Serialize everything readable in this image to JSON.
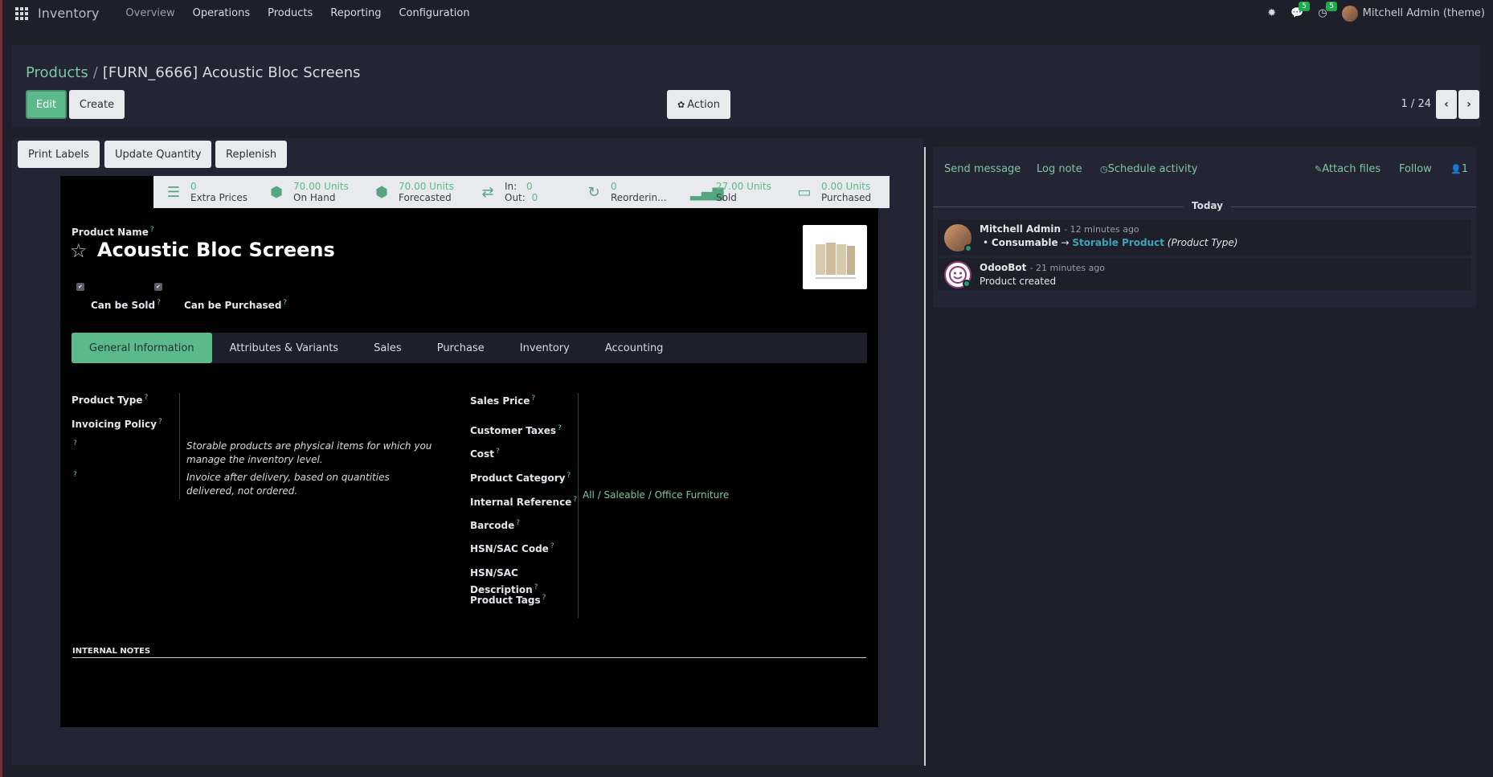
{
  "navbar": {
    "brand": "Inventory",
    "menu": [
      "Overview",
      "Operations",
      "Products",
      "Reporting",
      "Configuration"
    ],
    "messages_count": "5",
    "activities_count": "5",
    "user": "Mitchell Admin (theme)"
  },
  "control_panel": {
    "breadcrumb_parent": "Products",
    "breadcrumb_sep": "/",
    "breadcrumb_current": "[FURN_6666] Acoustic Bloc Screens",
    "edit_label": "Edit",
    "create_label": "Create",
    "action_label": "Action",
    "pager": "1 / 24"
  },
  "status_buttons": {
    "print_labels": "Print Labels",
    "update_quantity": "Update Quantity",
    "replenish": "Replenish"
  },
  "stats": [
    {
      "value": "0",
      "label": "Extra Prices",
      "icon": "list-icon"
    },
    {
      "value": "70.00 Units",
      "label": "On Hand",
      "icon": "cubes-icon"
    },
    {
      "value": "70.00 Units",
      "label": "Forecasted",
      "icon": "cubes-icon"
    },
    {
      "in_label": "In:",
      "in_value": "0",
      "out_label": "Out:",
      "out_value": "0",
      "icon": "exchange-icon"
    },
    {
      "value": "0",
      "label": "Reorderin...",
      "icon": "refresh-icon"
    },
    {
      "value": "27.00 Units",
      "label": "Sold",
      "icon": "signal-icon"
    },
    {
      "value": "0.00 Units",
      "label": "Purchased",
      "icon": "credit-card-icon"
    }
  ],
  "product": {
    "name_label": "Product Name",
    "name": "Acoustic Bloc Screens",
    "can_be_sold": "Can be Sold",
    "can_be_purchased": "Can be Purchased"
  },
  "tabs": [
    "General Information",
    "Attributes & Variants",
    "Sales",
    "Purchase",
    "Inventory",
    "Accounting"
  ],
  "general": {
    "product_type": "Product Type",
    "invoicing_policy": "Invoicing Policy",
    "help_type": "Storable products are physical items for which you manage the inventory level.",
    "help_invoice": "Invoice after delivery, based on quantities delivered, not ordered.",
    "sales_price": "Sales Price",
    "customer_taxes": "Customer Taxes",
    "cost": "Cost",
    "product_category": "Product Category",
    "category_value": "All / Saleable / Office Furniture",
    "internal_reference": "Internal Reference",
    "barcode": "Barcode",
    "hsn_code": "HSN/SAC Code",
    "hsn_desc_1": "HSN/SAC",
    "hsn_desc_2": "Description",
    "product_tags": "Product Tags",
    "internal_notes": "INTERNAL NOTES"
  },
  "chatter": {
    "send_message": "Send message",
    "log_note": "Log note",
    "schedule_activity": "Schedule activity",
    "attach_files": "Attach files",
    "follow": "Follow",
    "followers": "1",
    "today": "Today",
    "messages": [
      {
        "author": "Mitchell Admin",
        "date": "- 12 minutes ago",
        "old": "Consumable",
        "arrow": "→",
        "new": "Storable Product",
        "field": "(Product Type)"
      },
      {
        "author": "OdooBot",
        "date": "- 21 minutes ago",
        "body": "Product created"
      }
    ]
  }
}
